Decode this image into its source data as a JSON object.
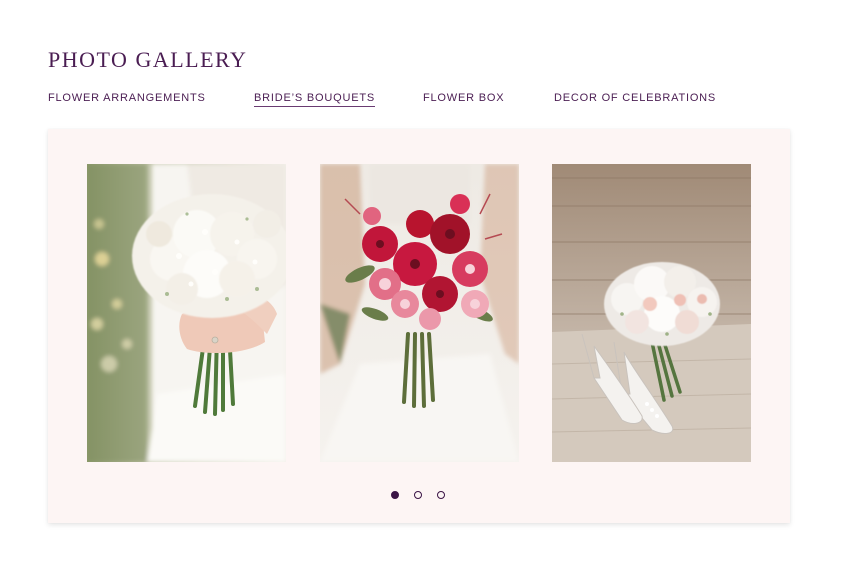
{
  "gallery": {
    "title": "PHOTO GALLERY",
    "tabs": [
      {
        "label": "FLOWER ARRANGEMENTS"
      },
      {
        "label": "BRIDE’S BOUQUETS"
      },
      {
        "label": "FLOWER BOX"
      },
      {
        "label": "DECOR OF CELEBRATIONS"
      }
    ],
    "active_tab": 1,
    "photos": [
      {
        "subject": "bride holding white bouquet"
      },
      {
        "subject": "bride holding red and pink bouquet"
      },
      {
        "subject": "white bouquet with bridal shoes on wooden floor"
      }
    ],
    "pagination": {
      "pages": 3,
      "current": 1
    }
  },
  "colors": {
    "text": "#4a1d52",
    "card_background": "#fdf5f4",
    "dot": "#3b1445"
  }
}
